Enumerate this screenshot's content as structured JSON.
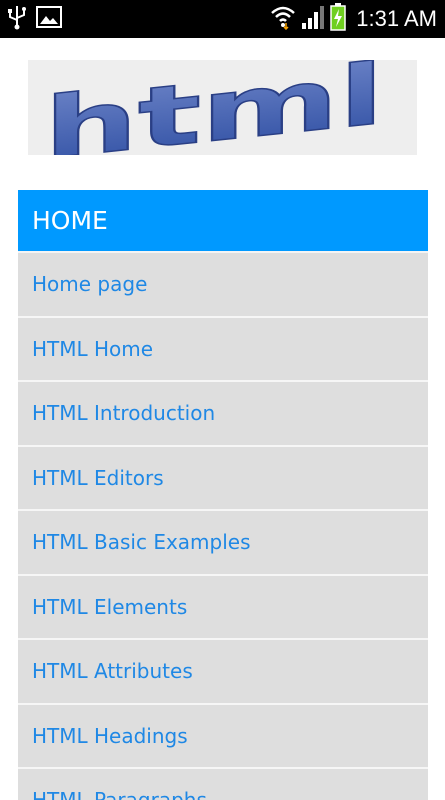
{
  "status_bar": {
    "time": "1:31 AM",
    "icons": [
      "usb-icon",
      "gallery-icon",
      "wifi-icon",
      "signal-icon",
      "battery-charging-icon"
    ]
  },
  "logo": {
    "text": "html"
  },
  "menu": {
    "header": "HOME",
    "items": [
      {
        "label": "Home page"
      },
      {
        "label": "HTML Home"
      },
      {
        "label": "HTML Introduction"
      },
      {
        "label": "HTML Editors"
      },
      {
        "label": "HTML Basic Examples"
      },
      {
        "label": "HTML Elements"
      },
      {
        "label": "HTML Attributes"
      },
      {
        "label": "HTML Headings"
      },
      {
        "label": "HTML Paragraphs"
      }
    ]
  },
  "colors": {
    "header_bg": "#0099ff",
    "item_bg": "#dedede",
    "link": "#1f88e5",
    "status_bar_bg": "#000000"
  }
}
